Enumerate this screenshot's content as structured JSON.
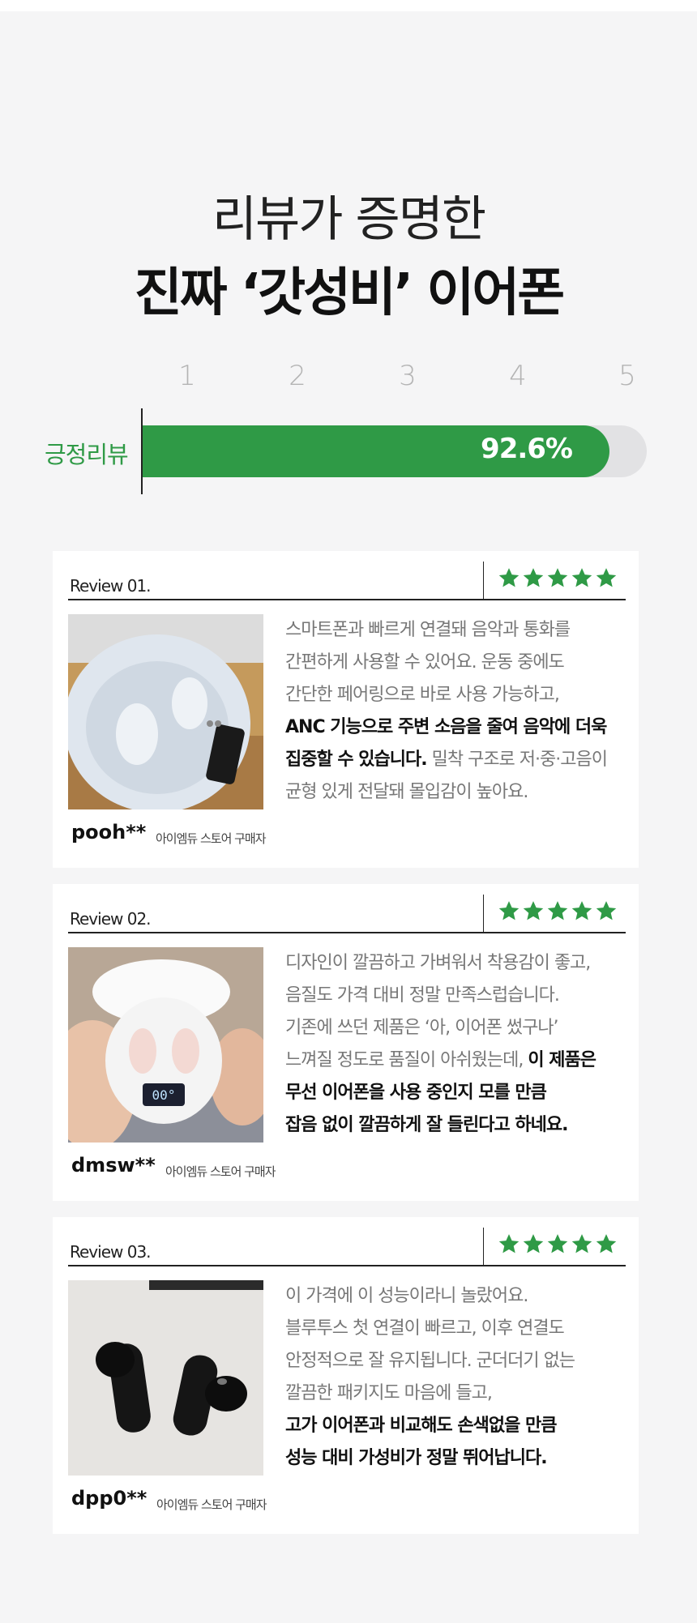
{
  "colors": {
    "accent": "#2f9a46",
    "track": "#e2e2e4",
    "page_bg": "#f5f5f6"
  },
  "headline": {
    "line1": "리뷰가 증명한",
    "line2": "진짜 ‘갓성비’ 이어폰"
  },
  "rating_chart": {
    "scale": [
      "1",
      "2",
      "3",
      "4",
      "5"
    ],
    "label": "긍정리뷰",
    "value_text": "92.6%",
    "percent": 92.6
  },
  "chart_data": {
    "type": "bar",
    "categories": [
      "긍정리뷰"
    ],
    "values": [
      92.6
    ],
    "xlim": [
      0,
      100
    ]
  },
  "reviews": [
    {
      "title": "Review 01.",
      "stars": 5,
      "reviewer": "pooh**",
      "buyer": "아이엠듀 스토어 구매자",
      "lines": [
        {
          "parts": [
            {
              "t": "스마트폰과 빠르게 연결돼 음악과 통화를",
              "b": false
            }
          ]
        },
        {
          "parts": [
            {
              "t": "간편하게 사용할 수 있어요. 운동 중에도",
              "b": false
            }
          ]
        },
        {
          "parts": [
            {
              "t": "간단한 페어링으로 바로 사용 가능하고,",
              "b": false
            }
          ]
        },
        {
          "parts": [
            {
              "t": "ANC 기능으로 주변 소음을 줄여 음악에 더욱",
              "b": true
            }
          ]
        },
        {
          "parts": [
            {
              "t": "집중할 수 있습니다.",
              "b": true
            },
            {
              "t": " 밀착 구조로 저·중·고음이",
              "b": false
            }
          ]
        },
        {
          "parts": [
            {
              "t": "균형 있게 전달돼 몰입감이 높아요.",
              "b": false
            }
          ]
        }
      ]
    },
    {
      "title": "Review 02.",
      "stars": 5,
      "reviewer": "dmsw**",
      "buyer": "아이엠듀 스토어 구매자",
      "lines": [
        {
          "parts": [
            {
              "t": "디자인이 깔끔하고 가벼워서 착용감이 좋고,",
              "b": false
            }
          ]
        },
        {
          "parts": [
            {
              "t": "음질도 가격 대비 정말 만족스럽습니다.",
              "b": false
            }
          ]
        },
        {
          "parts": [
            {
              "t": "기존에 쓰던 제품은 ‘아, 이어폰 썼구나’",
              "b": false
            }
          ]
        },
        {
          "parts": [
            {
              "t": "느껴질 정도로 품질이 아쉬웠는데, ",
              "b": false
            },
            {
              "t": "이 제품은",
              "b": true
            }
          ]
        },
        {
          "parts": [
            {
              "t": "무선 이어폰을 사용 중인지 모를 만큼",
              "b": true
            }
          ]
        },
        {
          "parts": [
            {
              "t": "잡음 없이 깔끔하게 잘 들린다고 하네요.",
              "b": true
            }
          ]
        }
      ]
    },
    {
      "title": "Review 03.",
      "stars": 5,
      "reviewer": "dpp0**",
      "buyer": "아이엠듀 스토어 구매자",
      "lines": [
        {
          "parts": [
            {
              "t": "이 가격에 이 성능이라니 놀랐어요.",
              "b": false
            }
          ]
        },
        {
          "parts": [
            {
              "t": "블루투스 첫 연결이 빠르고, 이후 연결도",
              "b": false
            }
          ]
        },
        {
          "parts": [
            {
              "t": "안정적으로 잘 유지됩니다. 군더더기 없는",
              "b": false
            }
          ]
        },
        {
          "parts": [
            {
              "t": "깔끔한 패키지도 마음에 들고,",
              "b": false
            }
          ]
        },
        {
          "parts": [
            {
              "t": "고가 이어폰과 비교해도 손색없을 만큼",
              "b": true
            }
          ]
        },
        {
          "parts": [
            {
              "t": "성능 대비 가성비가 정말 뛰어납니다.",
              "b": true
            }
          ]
        }
      ]
    }
  ]
}
